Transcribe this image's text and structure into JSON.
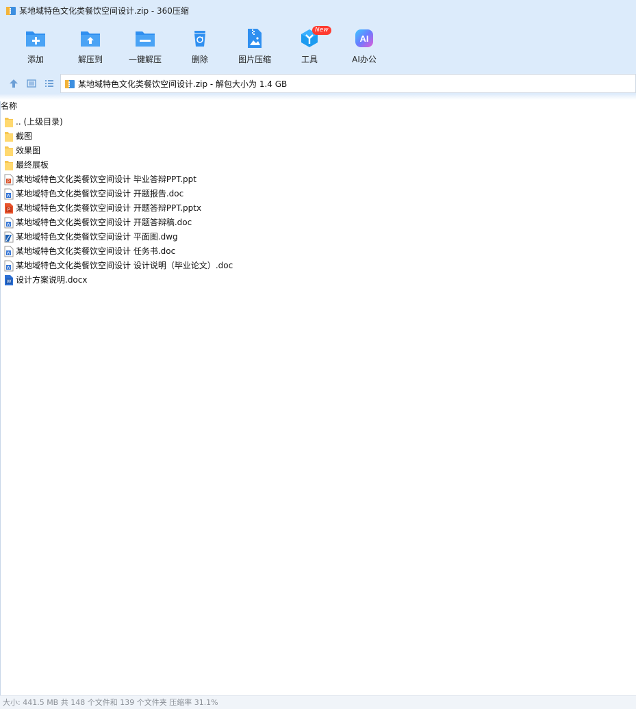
{
  "window": {
    "title": "某地域特色文化类餐饮空间设计.zip - 360压缩"
  },
  "toolbar": {
    "tools": [
      {
        "label": "添加",
        "icon": "add-folder-icon"
      },
      {
        "label": "解压到",
        "icon": "extract-to-icon"
      },
      {
        "label": "一键解压",
        "icon": "one-click-extract-icon"
      },
      {
        "label": "删除",
        "icon": "recycle-bin-icon"
      },
      {
        "label": "图片压缩",
        "icon": "image-compress-icon"
      },
      {
        "label": "工具",
        "icon": "tools-icon",
        "badge": "New"
      },
      {
        "label": "AI办公",
        "icon": "ai-office-icon",
        "icon_text": "AI"
      }
    ]
  },
  "address": {
    "path": "某地域特色文化类餐饮空间设计.zip - 解包大小为 1.4 GB"
  },
  "list": {
    "column_name": "名称",
    "items": [
      {
        "name": ".. (上级目录)",
        "type": "folder",
        "icon": "folder-icon"
      },
      {
        "name": "截图",
        "type": "folder",
        "icon": "folder-icon"
      },
      {
        "name": "效果图",
        "type": "folder",
        "icon": "folder-icon"
      },
      {
        "name": "最终展板",
        "type": "folder",
        "icon": "folder-icon"
      },
      {
        "name": "某地域特色文化类餐饮空间设计 毕业答辩PPT.ppt",
        "type": "ppt",
        "icon": "ppt-file-icon"
      },
      {
        "name": "某地域特色文化类餐饮空间设计 开题报告.doc",
        "type": "doc",
        "icon": "doc-file-icon"
      },
      {
        "name": "某地域特色文化类餐饮空间设计 开题答辩PPT.pptx",
        "type": "pptx",
        "icon": "pptx-file-icon"
      },
      {
        "name": "某地域特色文化类餐饮空间设计 开题答辩稿.doc",
        "type": "doc",
        "icon": "doc-file-icon"
      },
      {
        "name": "某地域特色文化类餐饮空间设计 平面图.dwg",
        "type": "dwg",
        "icon": "dwg-file-icon"
      },
      {
        "name": "某地域特色文化类餐饮空间设计 任务书.doc",
        "type": "doc",
        "icon": "doc-file-icon"
      },
      {
        "name": "某地域特色文化类餐饮空间设计 设计说明（毕业论文）.doc",
        "type": "doc",
        "icon": "doc-file-icon"
      },
      {
        "name": "设计方案说明.docx",
        "type": "docx",
        "icon": "docx-file-icon"
      }
    ]
  },
  "status": {
    "text": "大小: 441.5 MB 共 148 个文件和 139 个文件夹 压缩率 31.1%"
  },
  "colors": {
    "toolbar_bg": "#dcebfb",
    "icon_blue": "#2f8ff0",
    "badge_red": "#ff3b30",
    "folder_yellow": "#ffd970",
    "status_text": "#8a8f96"
  }
}
